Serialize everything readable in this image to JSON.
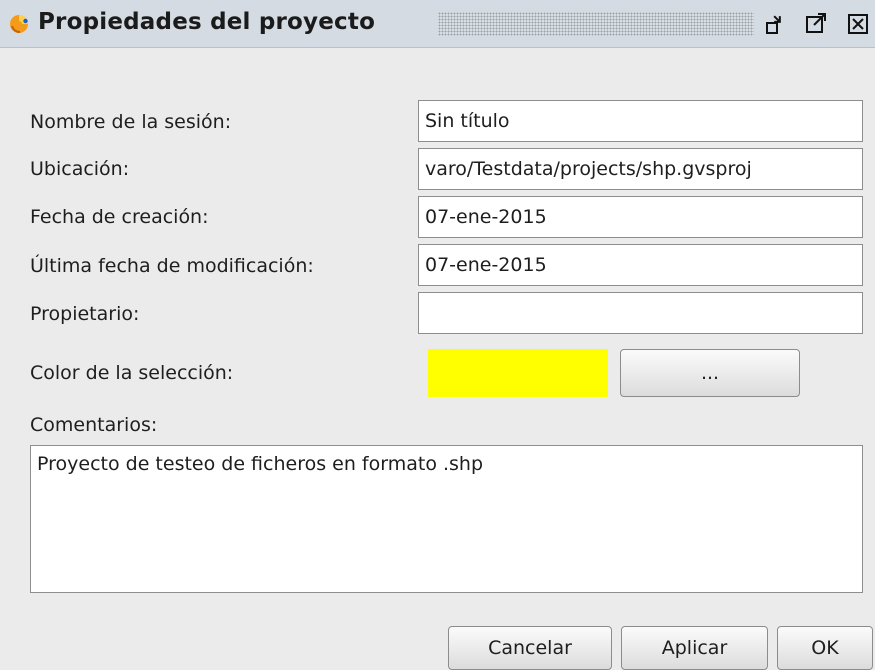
{
  "window": {
    "title": "Propiedades del proyecto",
    "app_icon": "gvsig-orange-icon",
    "buttons": [
      "minimize-icon",
      "maximize-icon",
      "close-icon"
    ]
  },
  "form": {
    "session_name": {
      "label": "Nombre de la sesión:",
      "value": "Sin título"
    },
    "location": {
      "label": "Ubicación:",
      "value": "/home/alvaro/Testdata/projects/shp.gvsproj",
      "visible_value": "varo/Testdata/projects/shp.gvsproj"
    },
    "creation_date": {
      "label": "Fecha de creación:",
      "value": "07-ene-2015"
    },
    "modification_date": {
      "label": "Última fecha de modificación:",
      "value": "07-ene-2015"
    },
    "owner": {
      "label": "Propietario:",
      "value": ""
    },
    "selection_color": {
      "label": "Color de la selección:",
      "color": "#ffff00",
      "button_label": "..."
    },
    "comments": {
      "label": "Comentarios:",
      "value": "Proyecto de testeo de ficheros en formato .shp"
    }
  },
  "actions": {
    "cancel": "Cancelar",
    "apply": "Aplicar",
    "ok": "OK"
  }
}
